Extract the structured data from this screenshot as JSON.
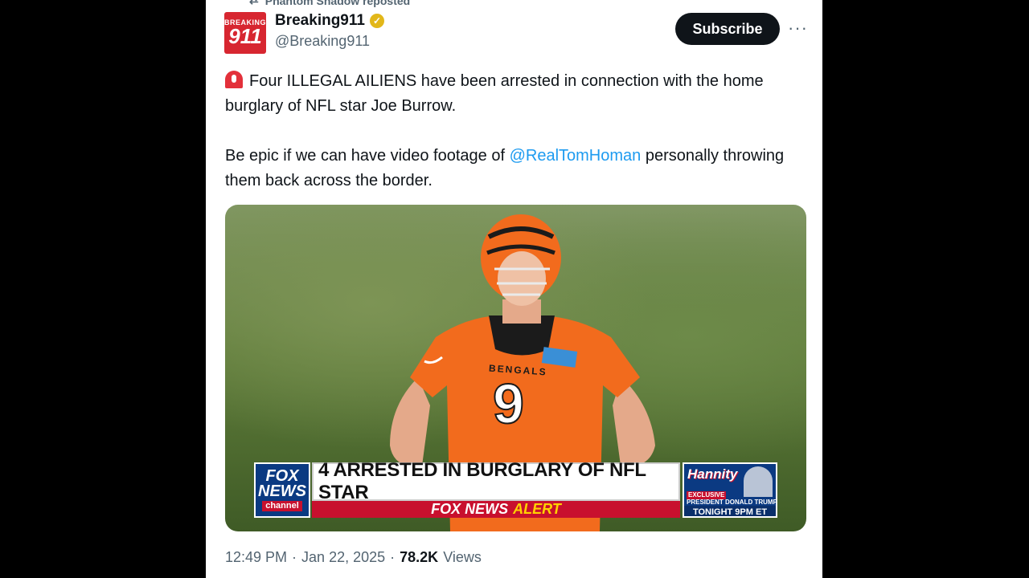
{
  "repost": {
    "icon": "repost-icon",
    "label": "Phantom Shadow reposted"
  },
  "author": {
    "avatar_top": "BREAKING",
    "avatar_number": "911",
    "display_name": "Breaking911",
    "verified_icon": "verified-badge-icon",
    "verified_color": "#e2b719",
    "handle": "@Breaking911"
  },
  "actions": {
    "subscribe_label": "Subscribe",
    "more_label": "···"
  },
  "tweet": {
    "emoji": "siren-icon",
    "line1": "Four ILLEGAL AILIENS have been arrested in connection with the home burglary of NFL star Joe Burrow.",
    "line2_before": "Be epic if we can have video footage of ",
    "mention": "@RealTomHoman",
    "line2_after": " personally throwing them back across the border.",
    "mention_color": "#1d9bf0"
  },
  "media": {
    "jersey_text": "BENGALS",
    "jersey_number": "9",
    "chyron": {
      "logo_line1": "FOX",
      "logo_line2": "NEWS",
      "logo_line3": "channel",
      "headline": "4 ARRESTED IN BURGLARY OF NFL STAR",
      "alert_brand": "FOX NEWS",
      "alert_word": "ALERT",
      "side_show": "Hannity",
      "side_exclusive": "EXCLUSIVE",
      "side_guest": "PRESIDENT DONALD TRUMP",
      "side_time": "TONIGHT 9PM ET"
    }
  },
  "meta": {
    "time": "12:49 PM",
    "separator": "·",
    "date": "Jan 22, 2025",
    "separator2": "·",
    "views_count": "78.2K",
    "views_label": "Views"
  }
}
